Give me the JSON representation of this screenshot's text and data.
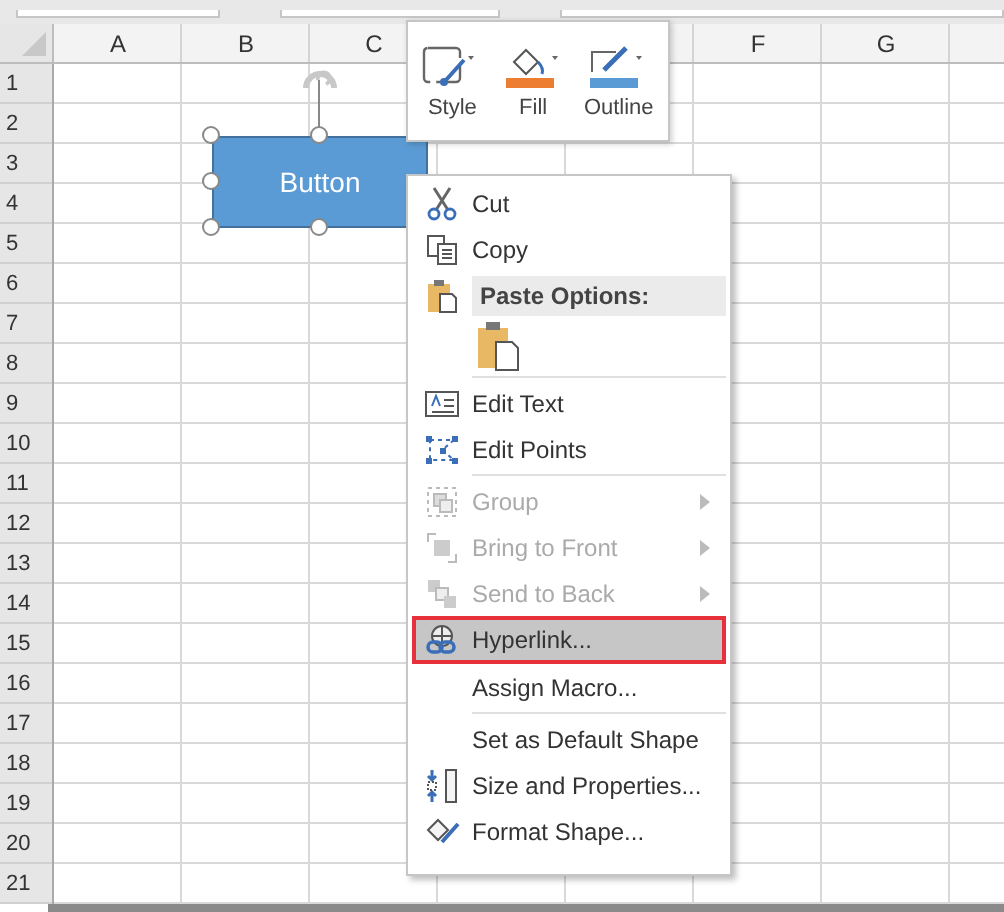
{
  "sheet": {
    "columns": [
      "A",
      "B",
      "C",
      "F",
      "G"
    ],
    "rows": [
      "1",
      "2",
      "3",
      "4",
      "5",
      "6",
      "7",
      "8",
      "9",
      "10",
      "11",
      "12",
      "13",
      "14",
      "15",
      "16",
      "17",
      "18",
      "19",
      "20",
      "21"
    ]
  },
  "shape": {
    "label": "Button",
    "selected": true
  },
  "mini_toolbar": {
    "buttons": [
      {
        "label": "Style"
      },
      {
        "label": "Fill"
      },
      {
        "label": "Outline"
      }
    ]
  },
  "context_menu": {
    "items": [
      {
        "kind": "command",
        "label": "Cut",
        "disabled": false,
        "submenu": false,
        "selected": false
      },
      {
        "kind": "command",
        "label": "Copy",
        "disabled": false,
        "submenu": false,
        "selected": false
      },
      {
        "kind": "header",
        "label": "Paste Options:"
      },
      {
        "kind": "paste"
      },
      {
        "kind": "separator"
      },
      {
        "kind": "command",
        "label": "Edit Text",
        "disabled": false,
        "submenu": false,
        "selected": false
      },
      {
        "kind": "command",
        "label": "Edit Points",
        "disabled": false,
        "submenu": false,
        "selected": false
      },
      {
        "kind": "separator"
      },
      {
        "kind": "command",
        "label": "Group",
        "disabled": true,
        "submenu": true,
        "selected": false
      },
      {
        "kind": "command",
        "label": "Bring to Front",
        "disabled": true,
        "submenu": true,
        "selected": false
      },
      {
        "kind": "command",
        "label": "Send to Back",
        "disabled": true,
        "submenu": true,
        "selected": false
      },
      {
        "kind": "command",
        "label": "Hyperlink...",
        "disabled": false,
        "submenu": false,
        "selected": true
      },
      {
        "kind": "command",
        "label": "Assign Macro...",
        "disabled": false,
        "submenu": false,
        "selected": false
      },
      {
        "kind": "separator"
      },
      {
        "kind": "command",
        "label": "Set as Default Shape",
        "disabled": false,
        "submenu": false,
        "selected": false
      },
      {
        "kind": "command",
        "label": "Size and Properties...",
        "disabled": false,
        "submenu": false,
        "selected": false
      },
      {
        "kind": "command",
        "label": "Format Shape...",
        "disabled": false,
        "submenu": false,
        "selected": false
      }
    ]
  }
}
